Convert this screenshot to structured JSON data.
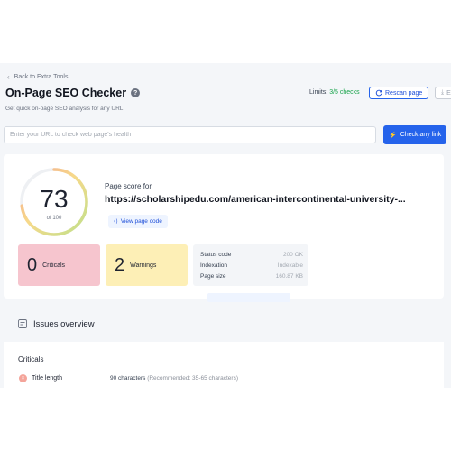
{
  "nav": {
    "back_label": "Back to Extra Tools"
  },
  "header": {
    "title": "On-Page SEO Checker",
    "subtitle": "Get quick on-page SEO analysis for any URL",
    "limits_label": "Limits:",
    "limits_value": "3/5 checks",
    "rescan_label": "Rescan page",
    "second_button_label": "Ex"
  },
  "search": {
    "placeholder": "Enter your URL to check web page's health",
    "button_label": "Check any link"
  },
  "score_card": {
    "score": "73",
    "of_label": "of 100",
    "score_fraction": 0.73,
    "page_score_label": "Page score for",
    "url": "https://scholarshipedu.com/american-intercontinental-university-...",
    "view_code_label": "View page code"
  },
  "stats": {
    "criticals_count": "0",
    "criticals_label": "Criticals",
    "warnings_count": "2",
    "warnings_label": "Warnings"
  },
  "page_info": [
    {
      "label": "Status code",
      "value": "200 OK"
    },
    {
      "label": "Indexation",
      "value": "Indexable"
    },
    {
      "label": "Page size",
      "value": "160.87 KB"
    }
  ],
  "issues": {
    "title": "Issues overview",
    "criticals_heading": "Criticals",
    "rows": [
      {
        "name": "Title length",
        "value": "90 characters",
        "recommendation": "(Recommended: 35-65 characters)"
      }
    ]
  },
  "colors": {
    "accent": "#2563eb",
    "criticals_bg": "#f6c5ce",
    "warnings_bg": "#fdefb6",
    "positive": "#16a34a"
  }
}
